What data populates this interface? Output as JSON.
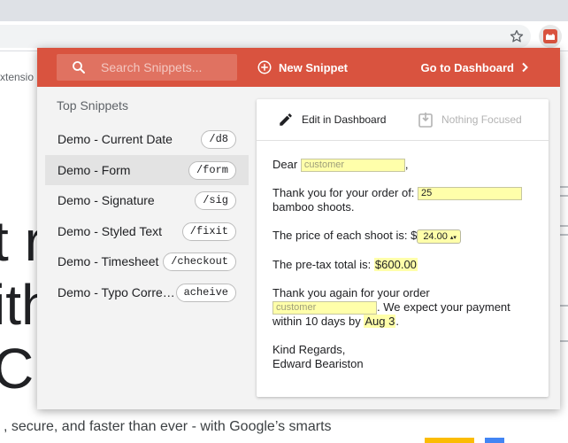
{
  "background": {
    "extension_partial": "xtensio",
    "big_lines": [
      "t r",
      "ith",
      "C"
    ],
    "bottom_text": ", secure, and faster than ever - with Google’s smarts"
  },
  "header": {
    "search_placeholder": "Search Snippets...",
    "new_snippet": "New Snippet",
    "go_dashboard": "Go to Dashboard"
  },
  "list": {
    "title": "Top Snippets",
    "items": [
      {
        "name": "Demo - Current Date",
        "shortcut": "/d8"
      },
      {
        "name": "Demo - Form",
        "shortcut": "/form"
      },
      {
        "name": "Demo - Signature",
        "shortcut": "/sig"
      },
      {
        "name": "Demo - Styled Text",
        "shortcut": "/fixit"
      },
      {
        "name": "Demo - Timesheet",
        "shortcut": "/checkout"
      },
      {
        "name": "Demo - Typo Correction",
        "shortcut": "acheive"
      }
    ]
  },
  "preview": {
    "edit_label": "Edit in Dashboard",
    "nothing_focused": "Nothing Focused",
    "dear": "Dear",
    "customer_placeholder": "customer",
    "comma": ",",
    "thank_line": "Thank you for your order of:",
    "order_qty": "25",
    "product": "bamboo shoots.",
    "price_line": "The price of each shoot is: $",
    "price_value": "24.00",
    "total_line": "The pre-tax total is:",
    "total_value": "$600.00",
    "thanks_again": "Thank you again for your order",
    "expect": ". We expect your payment",
    "within": "within 10 days by",
    "due_date": "Aug 3",
    "period": ".",
    "regards": "Kind Regards,",
    "signer": "Edward Beariston"
  },
  "colors": {
    "accent": "#d9533f",
    "field": "#ffffaa"
  }
}
